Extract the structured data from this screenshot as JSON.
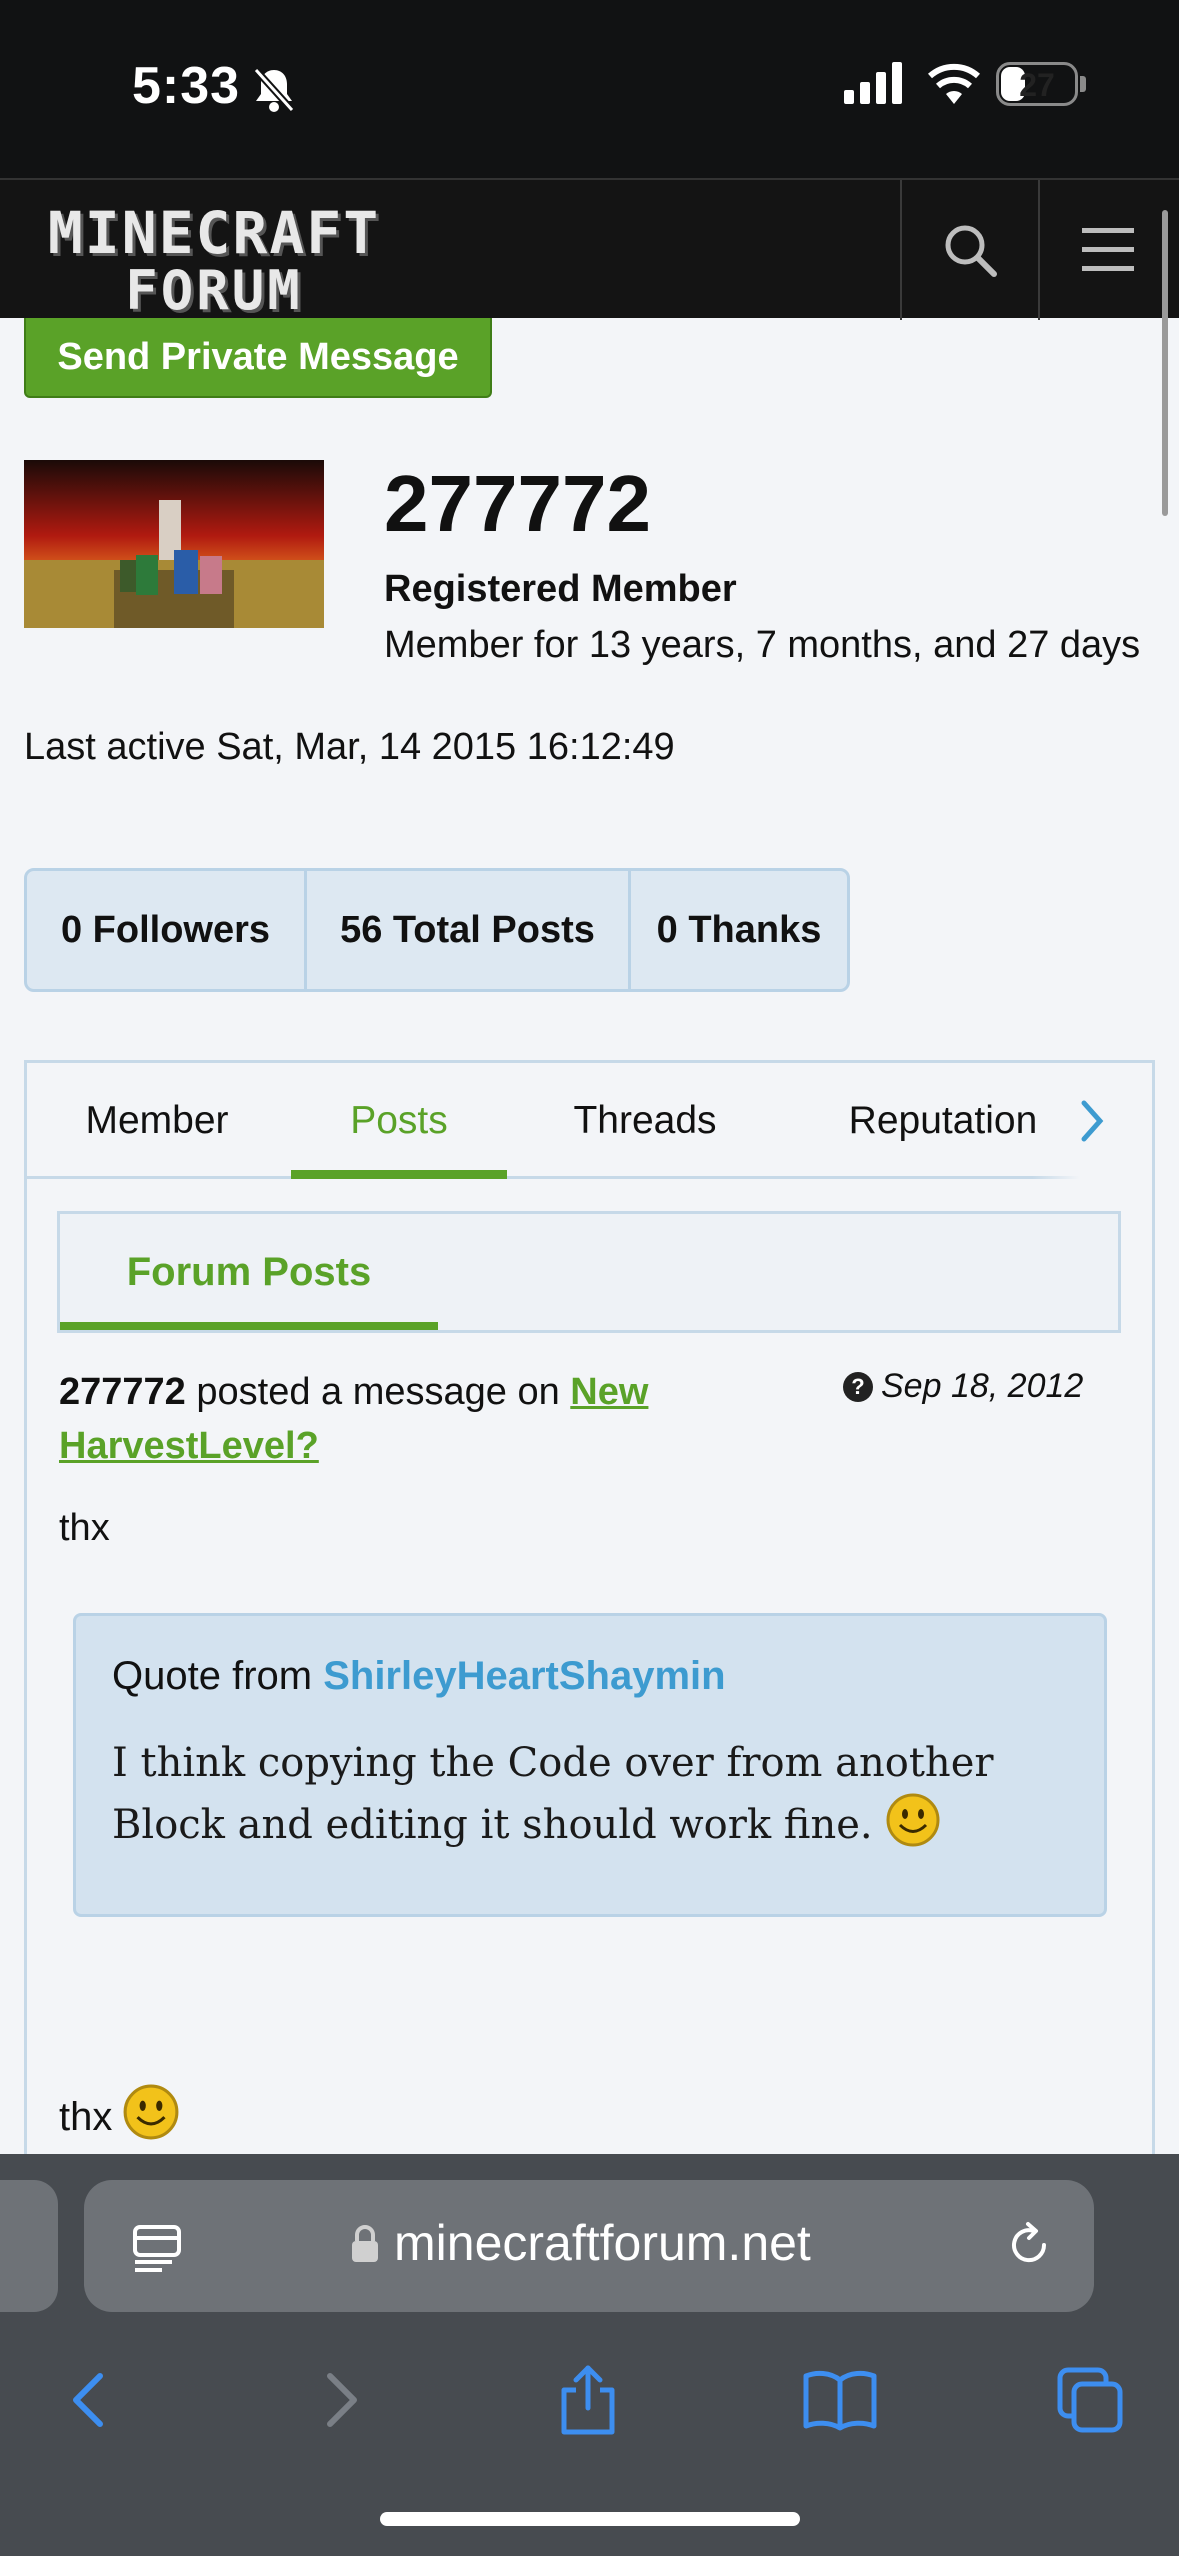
{
  "status_bar": {
    "time": "5:33",
    "battery": "27",
    "icons": [
      "bell-slash-icon",
      "signal-icon",
      "wifi-icon",
      "battery-icon"
    ]
  },
  "header": {
    "logo_line1": "MINECRAFT",
    "logo_line2": "FORUM",
    "icons": [
      "search-icon",
      "menu-icon"
    ]
  },
  "profile": {
    "pm_button": "Send Private Message",
    "username": "277772",
    "role": "Registered Member",
    "member_for": "Member for 13 years, 7 months, and 27 days",
    "last_active": "Last active Sat, Mar, 14 2015 16:12:49"
  },
  "stats": [
    "0 Followers",
    "56 Total Posts",
    "0 Thanks"
  ],
  "tabs": {
    "items": [
      "Member",
      "Posts",
      "Threads",
      "Reputation"
    ],
    "active": "Posts"
  },
  "sub_tab": "Forum Posts",
  "post": {
    "author": "277772",
    "action": "posted a message on",
    "thread": "New HarvestLevel?",
    "date": "Sep 18, 2012",
    "text": "thx",
    "quote_prefix": "Quote from",
    "quote_author": "ShirleyHeartShaymin",
    "quote_text": "I think copying the Code over from another Block and editing it should work fine.",
    "text2": "thx"
  },
  "browser": {
    "url": "minecraftforum.net"
  },
  "colors": {
    "accent_green": "#5aa228",
    "link_blue": "#3d9bd0",
    "panel_border": "#c6d9e8"
  }
}
